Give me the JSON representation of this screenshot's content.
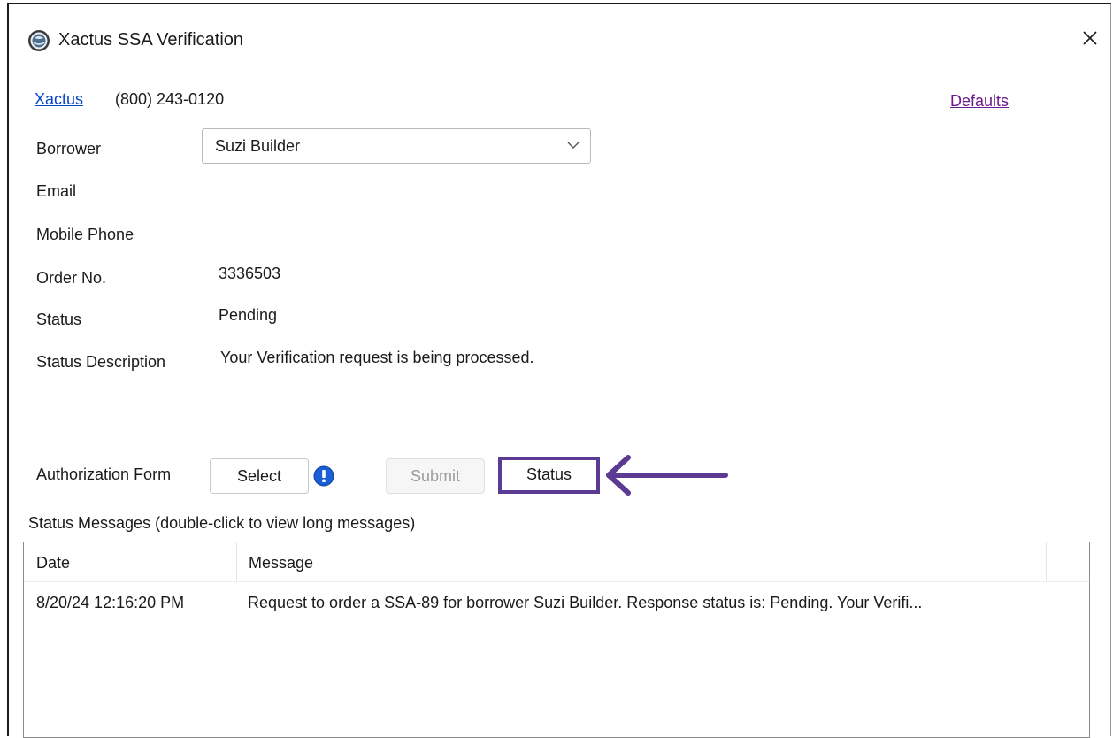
{
  "window": {
    "title": "Xactus SSA Verification"
  },
  "header": {
    "company_link": "Xactus",
    "phone": "(800) 243-0120",
    "defaults_link": "Defaults"
  },
  "form": {
    "borrower_label": "Borrower",
    "borrower_value": "Suzi Builder",
    "email_label": "Email",
    "email_value": "",
    "mobile_label": "Mobile Phone",
    "mobile_value": "",
    "order_label": "Order No.",
    "order_value": "3336503",
    "status_label": "Status",
    "status_value": "Pending",
    "status_desc_label": "Status Description",
    "status_desc_value": "Your Verification request is being processed."
  },
  "actions": {
    "auth_form_label": "Authorization Form",
    "select_label": "Select",
    "submit_label": "Submit",
    "status_label": "Status"
  },
  "messages": {
    "section_label": "Status Messages (double-click to view long messages)",
    "columns": [
      "Date",
      "Message"
    ],
    "rows": [
      {
        "date": "8/20/24 12:16:20 PM",
        "message": "Request to order a SSA-89 for borrower Suzi Builder. Response status is: Pending. Your Verifi..."
      }
    ]
  },
  "colors": {
    "link_blue": "#0645c7",
    "link_visited": "#6a1a8c",
    "highlight": "#5b3a93",
    "info_blue": "#1a5fd6"
  },
  "icons": {
    "app": "xactus-logo-icon",
    "close": "close-icon",
    "dropdown": "chevron-down-icon",
    "info": "info-icon",
    "annotation": "arrow-left-icon"
  }
}
